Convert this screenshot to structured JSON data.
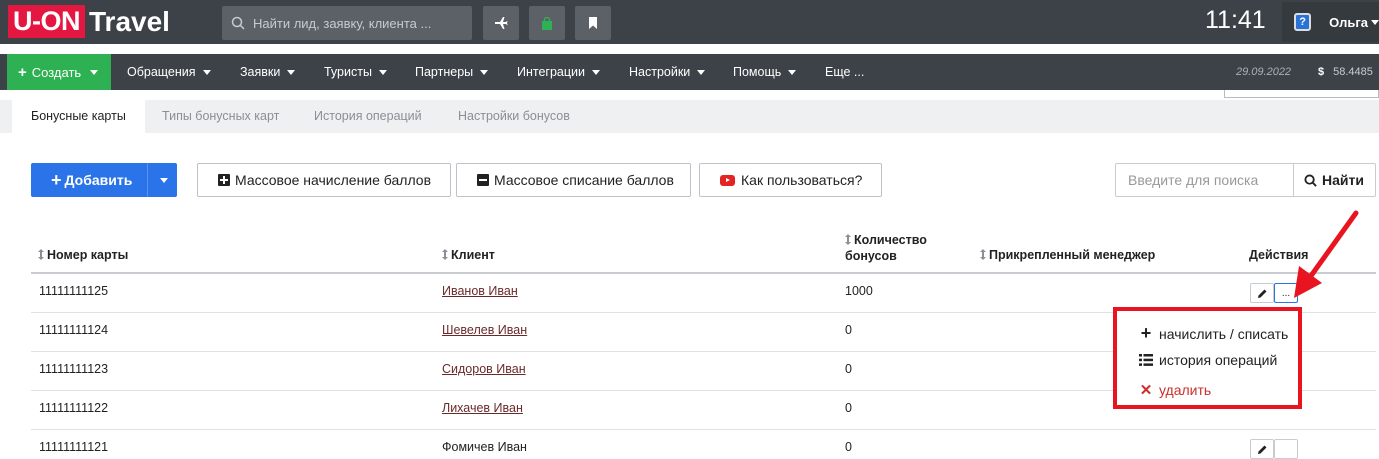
{
  "brand": {
    "part1": "U-ON",
    "part2": "Travel"
  },
  "search": {
    "placeholder": "Найти лид, заявку, клиента ..."
  },
  "clock": "11:41",
  "user": {
    "name": "Ольга"
  },
  "nav": {
    "create": "Создать",
    "items": [
      "Обращения",
      "Заявки",
      "Туристы",
      "Партнеры",
      "Интеграции",
      "Настройки",
      "Помощь",
      "Еще ..."
    ],
    "date": "29.09.2022",
    "currency_symbol": "$",
    "rate": "58.4485"
  },
  "tabs": [
    "Бонусные карты",
    "Типы бонусных карт",
    "История операций",
    "Настройки бонусов"
  ],
  "toolbar": {
    "add": "Добавить",
    "mass_add": "Массовое начисление баллов",
    "mass_remove": "Массовое списание баллов",
    "howto": "Как пользоваться?",
    "search_placeholder": "Введите для поиска",
    "search_button": "Найти"
  },
  "table": {
    "headers": {
      "card": "Номер карты",
      "client": "Клиент",
      "bonus_line1": "Количество",
      "bonus_line2": "бонусов",
      "manager": "Прикрепленный менеджер",
      "actions": "Действия"
    },
    "rows": [
      {
        "card": "11111111125",
        "client": "Иванов Иван",
        "bonus": "1000"
      },
      {
        "card": "11111111124",
        "client": "Шевелев Иван",
        "bonus": "0"
      },
      {
        "card": "11111111123",
        "client": "Сидоров Иван",
        "bonus": "0"
      },
      {
        "card": "11111111122",
        "client": "Лихачев Иван",
        "bonus": "0"
      },
      {
        "card": "11111111121",
        "client": "Фомичев Иван",
        "bonus": "0"
      }
    ]
  },
  "actions_menu": {
    "more_label": "...",
    "items": [
      "начислить / списать",
      "история операций",
      "удалить"
    ]
  },
  "colors": {
    "brand_red": "#e3173f",
    "create_green": "#2eb152",
    "primary_blue": "#2a73e8",
    "highlight_red": "#e8141f"
  }
}
